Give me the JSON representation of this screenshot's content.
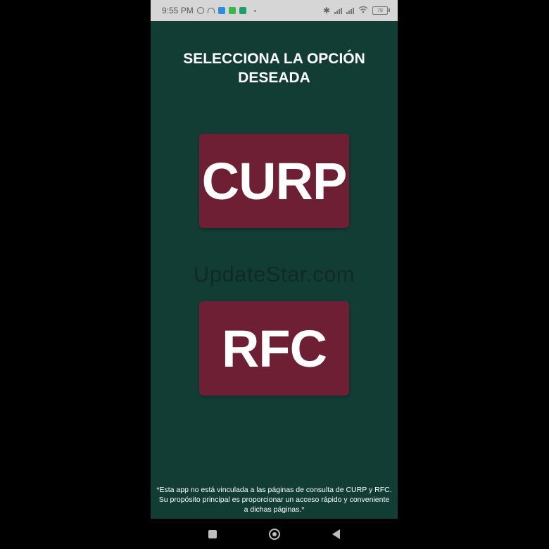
{
  "status_bar": {
    "time": "9:55 PM",
    "icons": [
      "alarm-icon",
      "headset-icon",
      "app-notification-icon",
      "app-notification-icon",
      "app-notification-icon"
    ],
    "battery": "78"
  },
  "screen": {
    "title_line1": "SELECCIONA LA OPCIÓN",
    "title_line2": "DESEADA",
    "options": [
      {
        "label": "CURP"
      },
      {
        "label": "RFC"
      }
    ],
    "watermark": "UpdateStar.com",
    "disclaimer": "*Esta app no está vinculada a las páginas de consulta de CURP y RFC. Su propósito principal es proporcionar un acceso rápido y conveniente a dichas páginas.*"
  },
  "navigation": {
    "buttons": [
      "recent-apps",
      "home",
      "back"
    ]
  },
  "colors": {
    "background": "#123d35",
    "button": "#6e1f33",
    "text": "#ffffff",
    "status_bar": "#d6d6d6"
  }
}
